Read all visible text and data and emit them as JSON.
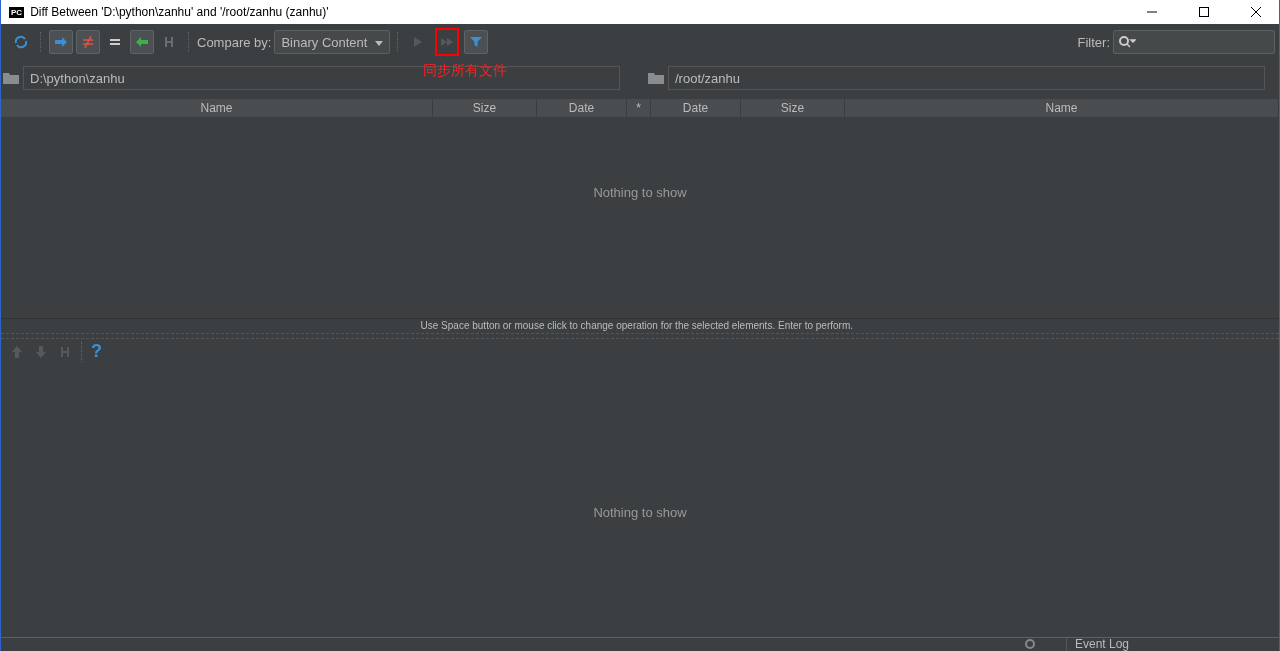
{
  "window": {
    "title": "Diff Between 'D:\\python\\zanhu' and '/root/zanhu (zanhu)'",
    "app_badge": "PC"
  },
  "toolbar": {
    "toggles": [
      {
        "kind": "right",
        "selected": true
      },
      {
        "kind": "notequal",
        "selected": true
      },
      {
        "kind": "equal",
        "selected": false
      },
      {
        "kind": "left",
        "selected": true
      }
    ],
    "compare_label": "Compare by:",
    "compare_value": "Binary Content",
    "filter_label": "Filter:",
    "annotation": "同步所有文件"
  },
  "paths": {
    "left": "D:\\python\\zanhu",
    "right": "/root/zanhu"
  },
  "table": {
    "columns": [
      {
        "label": "Name"
      },
      {
        "label": "Size"
      },
      {
        "label": "Date"
      },
      {
        "label": "*"
      },
      {
        "label": "Date"
      },
      {
        "label": "Size"
      },
      {
        "label": "Name"
      }
    ],
    "empty": "Nothing to show"
  },
  "hint": "Use Space button or mouse click to change operation for the selected elements. Enter to perform.",
  "lower": {
    "help": "?",
    "empty": "Nothing to show"
  },
  "status_bar": {
    "event_log": "Event Log"
  }
}
